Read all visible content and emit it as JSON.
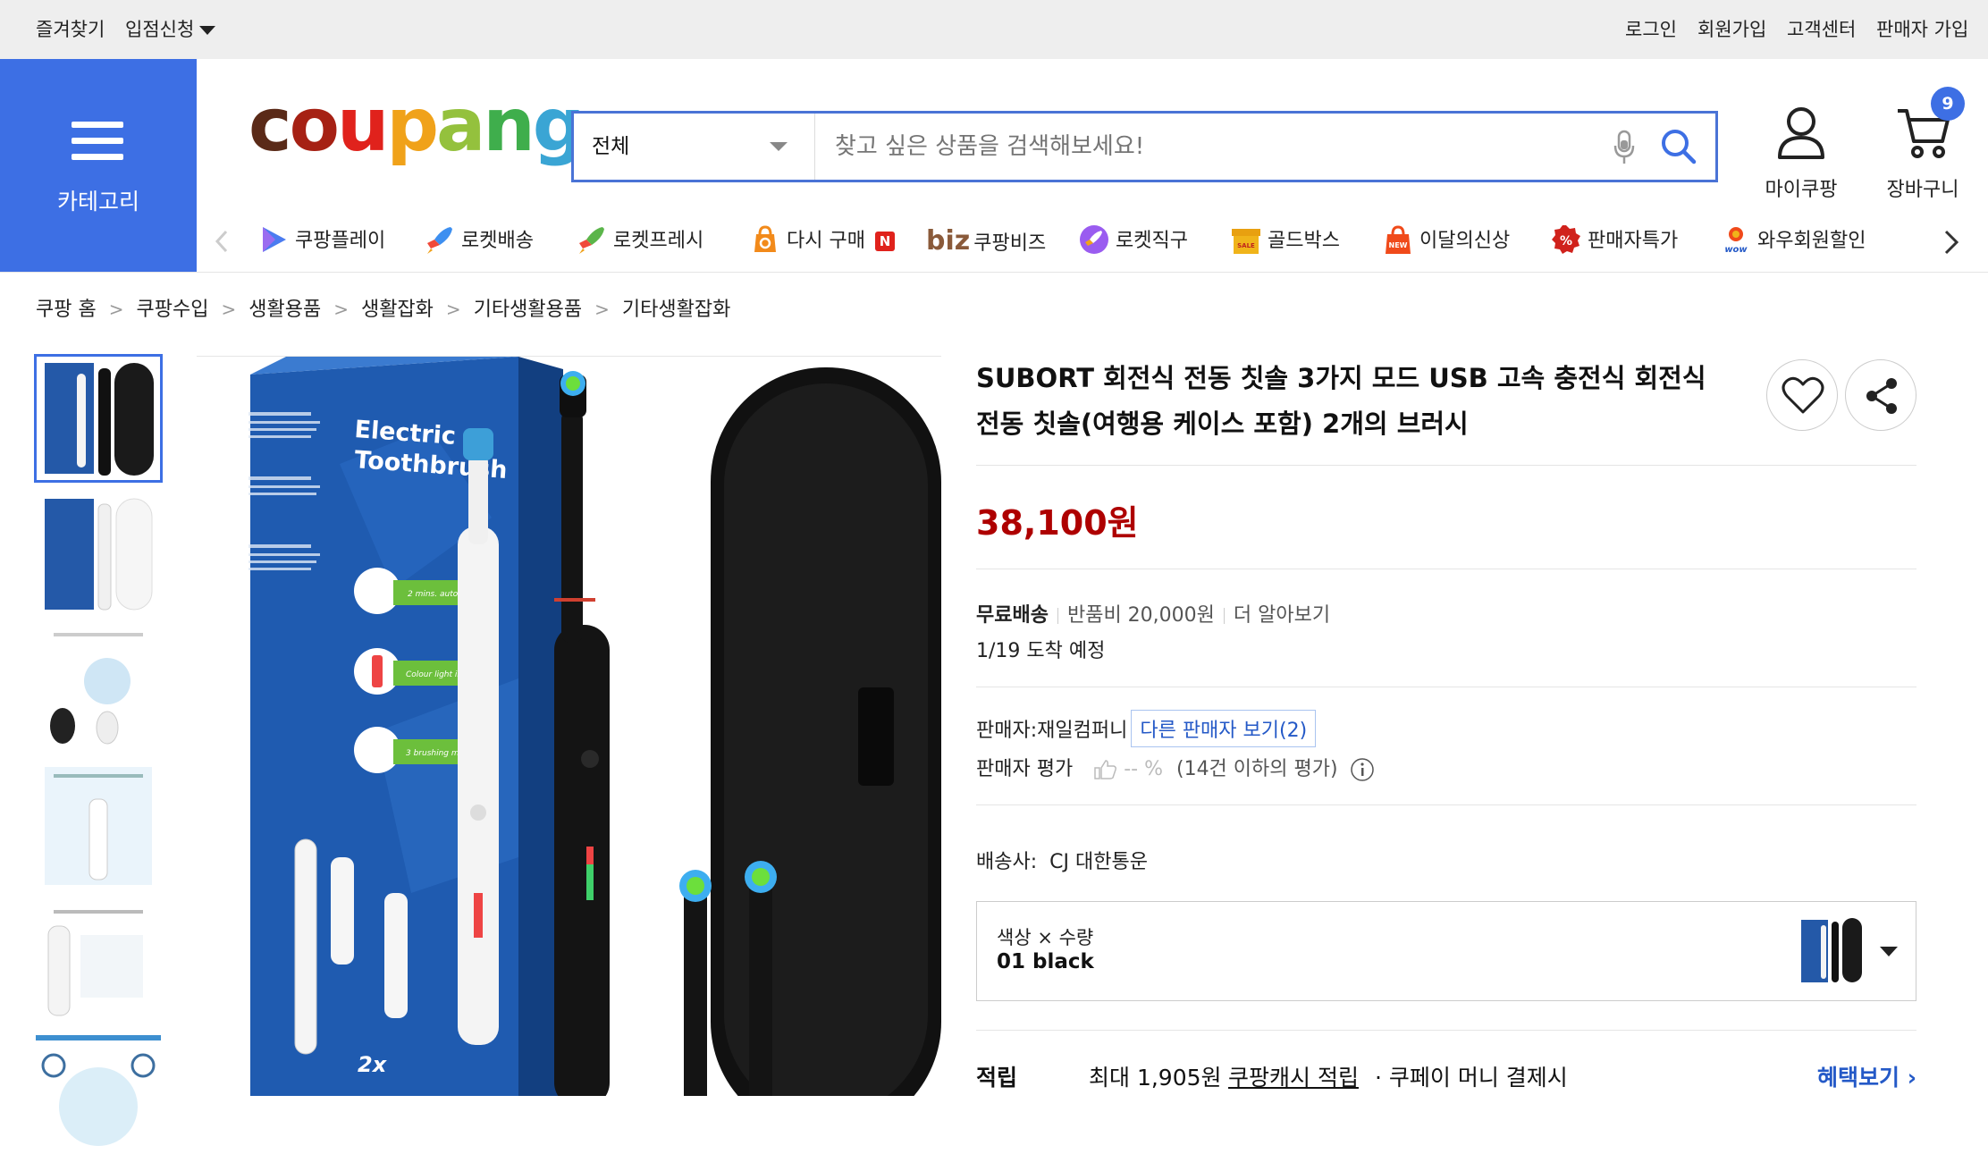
{
  "topbar": {
    "favorites": "즐겨찾기",
    "store_apply": "입점신청",
    "login": "로그인",
    "signup": "회원가입",
    "customer_center": "고객센터",
    "seller_signup": "판매자 가입"
  },
  "category_button": {
    "label": "카테고리"
  },
  "logo": {
    "text": "coupang"
  },
  "search": {
    "scope": "전체",
    "placeholder": "찾고 싶은 상품을 검색해보세요!"
  },
  "header_icons": {
    "mycoupang": "마이쿠팡",
    "cart": "장바구니",
    "cart_count": "9"
  },
  "subnav": [
    {
      "label": "쿠팡플레이",
      "icon": "play-icon"
    },
    {
      "label": "로켓배송",
      "icon": "rocket-icon"
    },
    {
      "label": "로켓프레시",
      "icon": "rocket-fresh-icon"
    },
    {
      "label": "다시 구매",
      "icon": "rebuy-icon",
      "badge": "N"
    },
    {
      "label": "쿠팡비즈",
      "icon": "biz-icon",
      "prefix": "biz"
    },
    {
      "label": "로켓직구",
      "icon": "rocket-global-icon"
    },
    {
      "label": "골드박스",
      "icon": "goldbox-icon"
    },
    {
      "label": "이달의신상",
      "icon": "new-bag-icon"
    },
    {
      "label": "판매자특가",
      "icon": "percent-icon"
    },
    {
      "label": "와우회원할인",
      "icon": "wow-icon"
    }
  ],
  "breadcrumb": [
    "쿠팡 홈",
    "쿠팡수입",
    "생활용품",
    "생활잡화",
    "기타생활용품",
    "기타생활잡화"
  ],
  "product": {
    "title": "SUBORT 회전식 전동 칫솔 3가지 모드 USB 고속 충전식 회전식 전동 칫솔(여행용 케이스 포함) 2개의 브러시",
    "price": "38,100원",
    "shipping_free": "무료배송",
    "return_fee": "반품비 20,000원",
    "learn_more": "더 알아보기",
    "arrival": "1/19 도착 예정",
    "seller_label": "판매자:",
    "seller_name": "재일컴퍼니",
    "other_sellers": "다른 판매자 보기(2)",
    "seller_rating_label": "판매자 평가",
    "seller_rating_value": "-- %",
    "seller_rating_note": "(14건 이하의 평가)",
    "carrier_label": "배송사:",
    "carrier_name": "CJ 대한통운",
    "option_label": "색상 × 수량",
    "option_value": "01 black",
    "reward_label": "적립",
    "reward_max": "최대 1,905원",
    "reward_link": "쿠팡캐시 적립",
    "reward_note": "· 쿠페이 머니 결제시",
    "benefits": "혜택보기"
  },
  "image_text": {
    "box_title_1": "Electric",
    "box_title_2": "Toothbrush",
    "feature_1": "2 mins. auto timer",
    "feature_2": "Colour light indicator",
    "feature_3": "3 brushing modes",
    "count": "2x"
  },
  "colors": {
    "accent_blue": "#3d6fe4",
    "price_red": "#ae0000",
    "topbar_bg": "#eeeeee"
  }
}
